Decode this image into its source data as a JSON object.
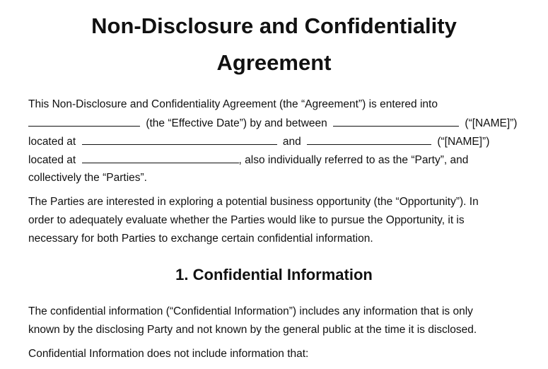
{
  "title": {
    "line1": "Non-Disclosure and Confidentiality",
    "line2": "Agreement"
  },
  "intro": {
    "line1": "This Non-Disclosure and Confidentiality Agreement (the “Agreement”) is entered into",
    "line2_a": "(the “Effective Date”) by and between",
    "line2_b": "(“[NAME]”)",
    "line3_a": "located at",
    "line3_b": "and",
    "line3_c": "(“[NAME]”)",
    "line4_a": "located at",
    "line4_b": ", also individually referred to as the “Party”, and",
    "line5": "collectively the “Parties”."
  },
  "purpose": {
    "line1": "The Parties are interested in exploring a potential business opportunity (the “Opportunity”). In",
    "line2": "order to adequately evaluate whether the Parties would like to pursue the Opportunity, it is",
    "line3": "necessary for both Parties to exchange certain confidential information."
  },
  "section1": {
    "heading": "1. Confidential Information",
    "p1_line1": "The confidential information (“Confidential Information”) includes any information that is only",
    "p1_line2": "known by the disclosing Party and not known by the general public at the time it is disclosed.",
    "p2_line1": "Confidential Information does not include information that:"
  }
}
